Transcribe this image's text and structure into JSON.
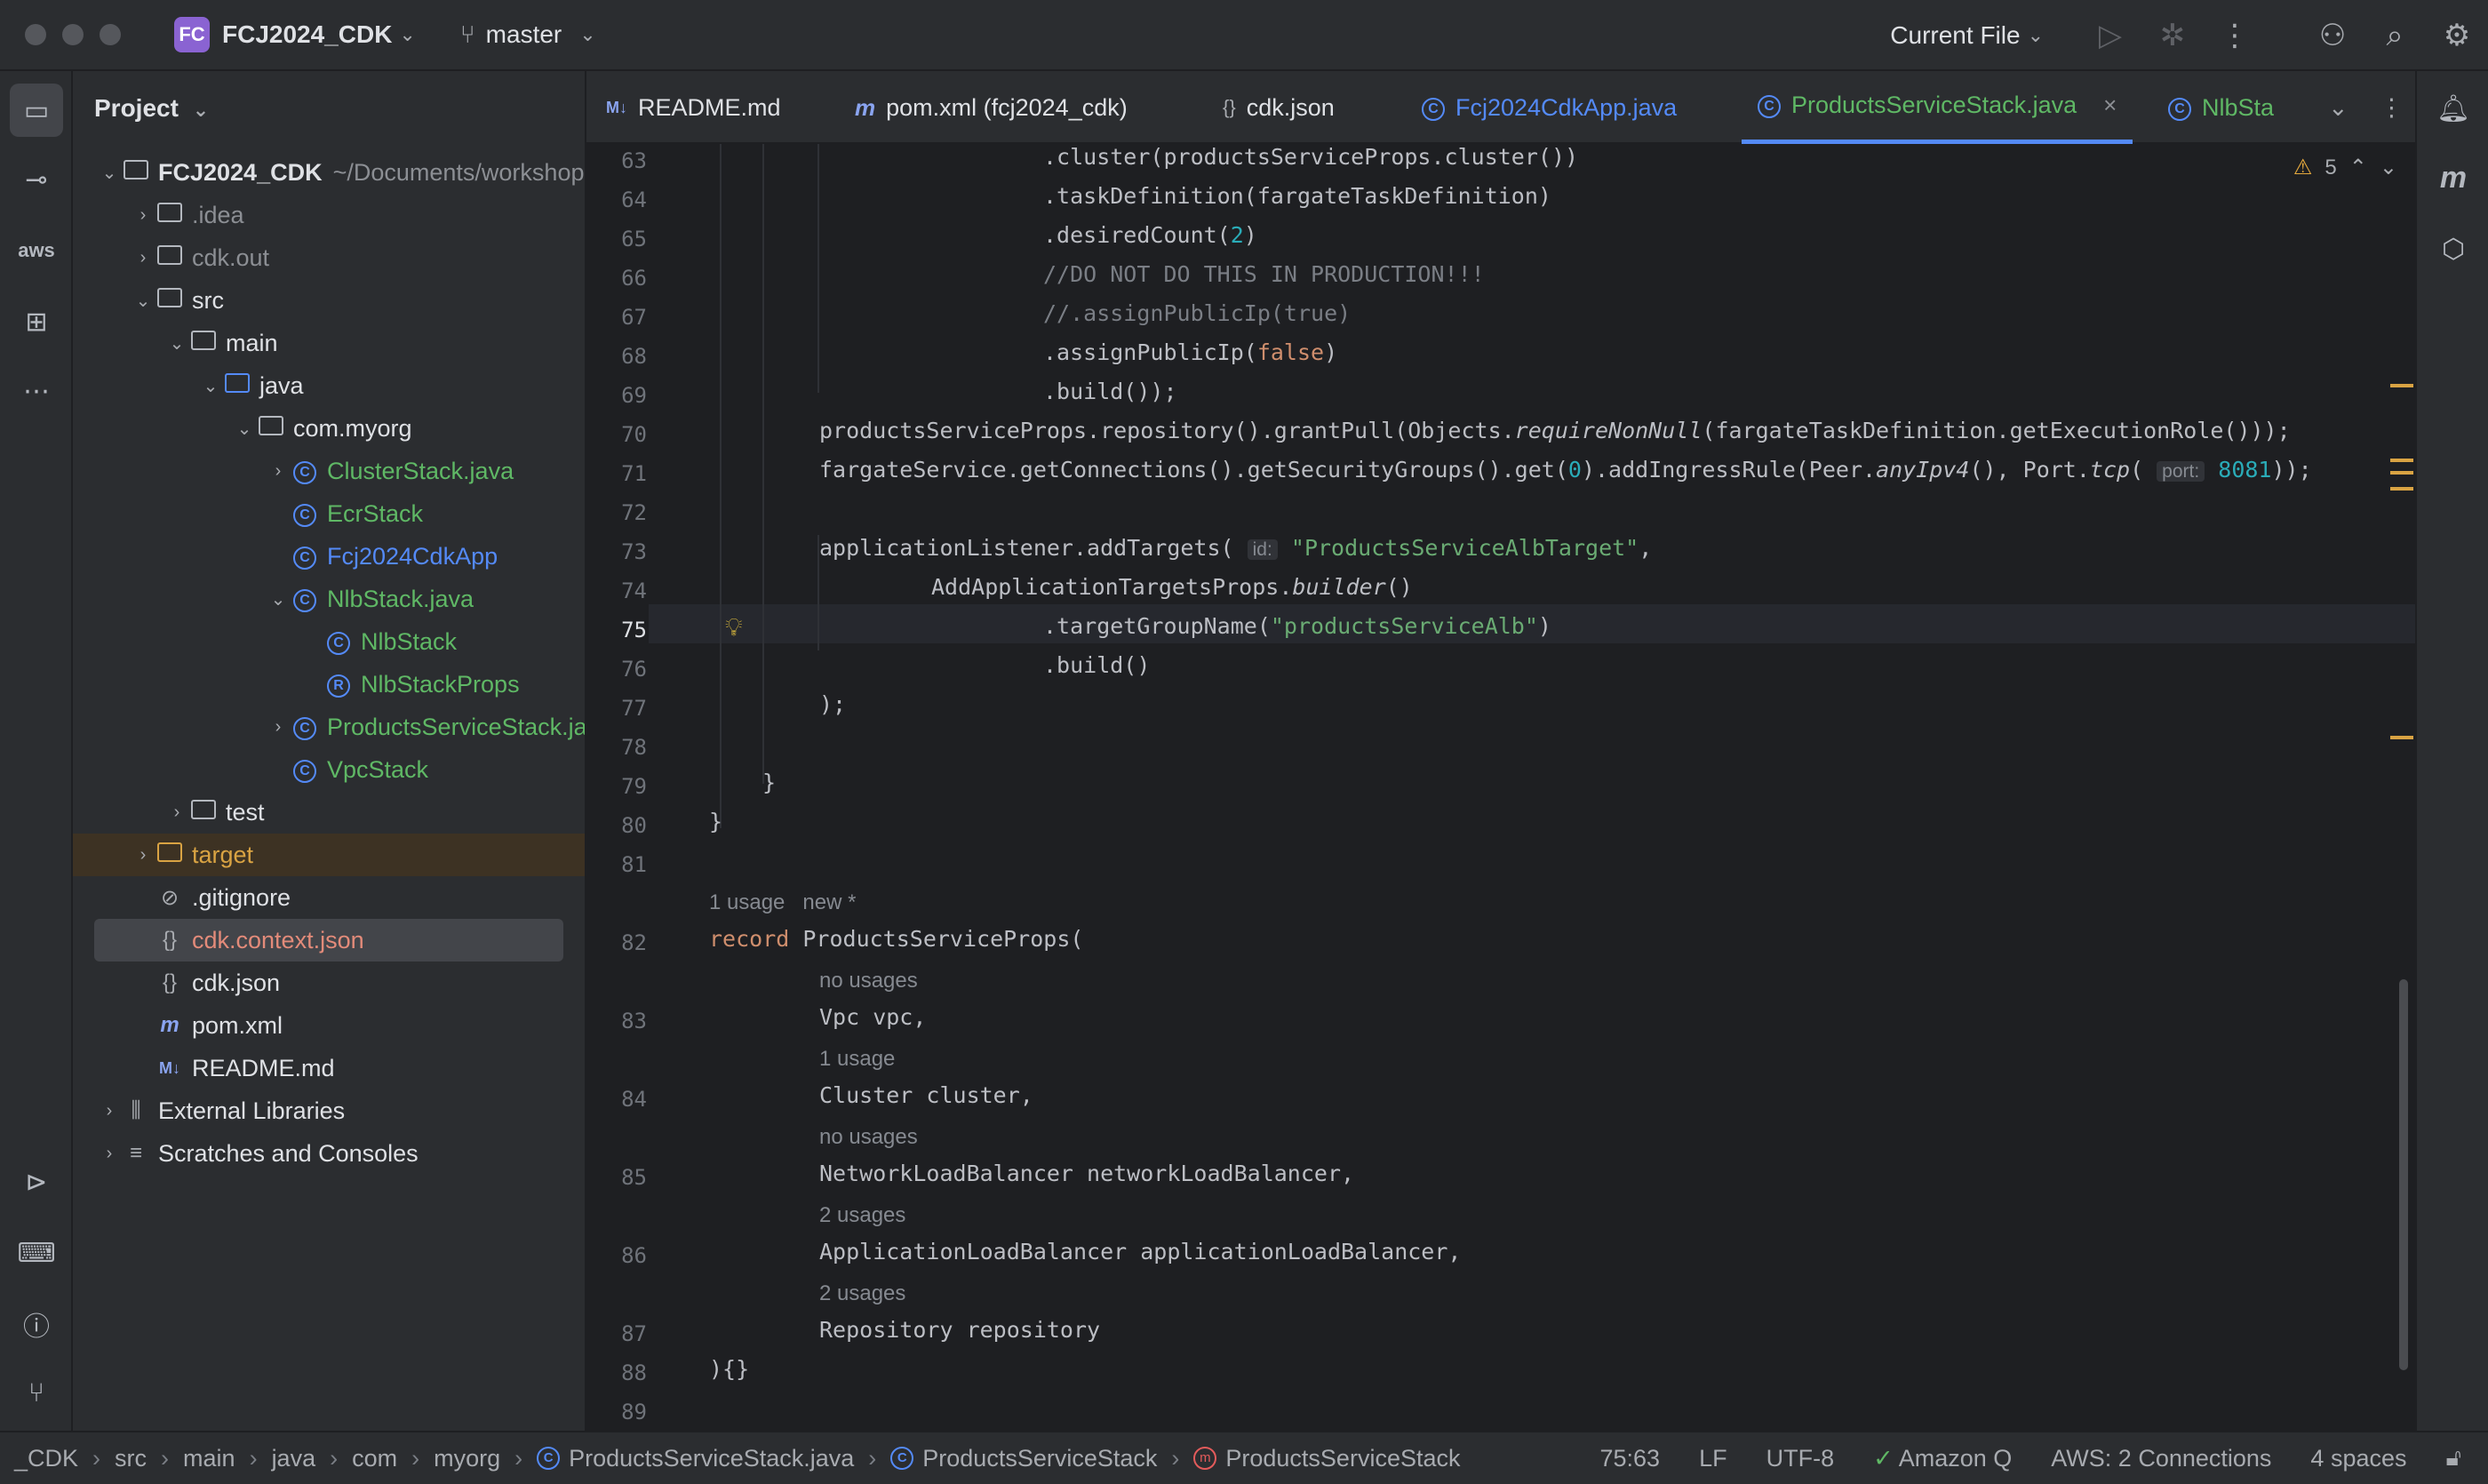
{
  "titlebar": {
    "project_badge": "FC",
    "project_name": "FCJ2024_CDK",
    "branch": "master",
    "run_config": "Current File"
  },
  "project_panel": {
    "title": "Project",
    "root_name": "FCJ2024_CDK",
    "root_path": "~/Documents/workshop",
    "items": [
      {
        "label": ".idea"
      },
      {
        "label": "cdk.out"
      },
      {
        "label": "src"
      },
      {
        "label": "main"
      },
      {
        "label": "java"
      },
      {
        "label": "com.myorg"
      },
      {
        "label": "ClusterStack.java"
      },
      {
        "label": "EcrStack"
      },
      {
        "label": "Fcj2024CdkApp"
      },
      {
        "label": "NlbStack.java"
      },
      {
        "label": "NlbStack"
      },
      {
        "label": "NlbStackProps"
      },
      {
        "label": "ProductsServiceStack.java"
      },
      {
        "label": "VpcStack"
      },
      {
        "label": "test"
      },
      {
        "label": "target"
      },
      {
        "label": ".gitignore"
      },
      {
        "label": "cdk.context.json"
      },
      {
        "label": "cdk.json"
      },
      {
        "label": "pom.xml"
      },
      {
        "label": "README.md"
      },
      {
        "label": "External Libraries"
      },
      {
        "label": "Scratches and Consoles"
      }
    ]
  },
  "tabs": [
    {
      "icon": "M↓",
      "label": "README.md"
    },
    {
      "icon": "m",
      "label": "pom.xml (fcj2024_cdk)"
    },
    {
      "icon": "{}",
      "label": "cdk.json"
    },
    {
      "icon": "C",
      "label": "Fcj2024CdkApp.java"
    },
    {
      "icon": "C",
      "label": "ProductsServiceStack.java"
    },
    {
      "icon": "C",
      "label": "NlbStack"
    }
  ],
  "editor": {
    "warning_count": "5",
    "line_numbers": [
      "63",
      "64",
      "65",
      "66",
      "67",
      "68",
      "69",
      "70",
      "71",
      "72",
      "73",
      "74",
      "75",
      "76",
      "77",
      "78",
      "79",
      "80",
      "81",
      "82",
      "83",
      "84",
      "85",
      "86",
      "87",
      "88",
      "89"
    ],
    "current_line": "75",
    "code": {
      "l63": ".cluster(productsServiceProps.cluster())",
      "l64": ".taskDefinition(fargateTaskDefinition)",
      "l65a": ".desiredCount(",
      "l65n": "2",
      "l65b": ")",
      "l66": "//DO NOT DO THIS IN PRODUCTION!!!",
      "l67": "//.assignPublicIp(true)",
      "l68a": ".assignPublicIp(",
      "l68k": "false",
      "l68b": ")",
      "l69": ".build());",
      "l70a": "productsServiceProps.repository().grantPull(Objects.",
      "l70i": "requireNonNull",
      "l70b": "(fargateTaskDefinition.getExecutionRole()));",
      "l71a": "fargateService.getConnections().getSecurityGroups().get(",
      "l71n": "0",
      "l71b": ").addIngressRule(Peer.",
      "l71i": "anyIpv4",
      "l71c": "(), Port.",
      "l71i2": "tcp",
      "l71d": "( ",
      "l71hint": "port:",
      "l71n2": "8081",
      "l71e": "));",
      "l73a": "applicationListener.addTargets( ",
      "l73hint": "id:",
      "l73s": "\"ProductsServiceAlbTarget\"",
      "l73b": ",",
      "l74a": "AddApplicationTargetsProps.",
      "l74i": "builder",
      "l74b": "()",
      "l75a": ".targetGroupName(",
      "l75s": "\"productsServiceAlb\"",
      "l75b": ")",
      "l76": ".build()",
      "l77": ");",
      "l79": "}",
      "l80": "}",
      "hint81": "1 usage   new *",
      "l82k": "record",
      "l82a": " ProductsServiceProps(",
      "hint82": "no usages",
      "l83": "Vpc vpc,",
      "hint83": "1 usage",
      "l84": "Cluster cluster,",
      "hint84": "no usages",
      "l85": "NetworkLoadBalancer networkLoadBalancer,",
      "hint85": "2 usages",
      "l86": "ApplicationLoadBalancer applicationLoadBalancer,",
      "hint86": "2 usages",
      "l87": "Repository repository",
      "l88": "){}"
    }
  },
  "statusbar": {
    "breadcrumbs": [
      "_CDK",
      "src",
      "main",
      "java",
      "com",
      "myorg",
      "ProductsServiceStack.java",
      "ProductsServiceStack",
      "ProductsServiceStack"
    ],
    "position": "75:63",
    "line_ending": "LF",
    "encoding": "UTF-8",
    "amazon_q": "Amazon Q",
    "aws": "AWS: 2 Connections",
    "indent": "4 spaces"
  }
}
